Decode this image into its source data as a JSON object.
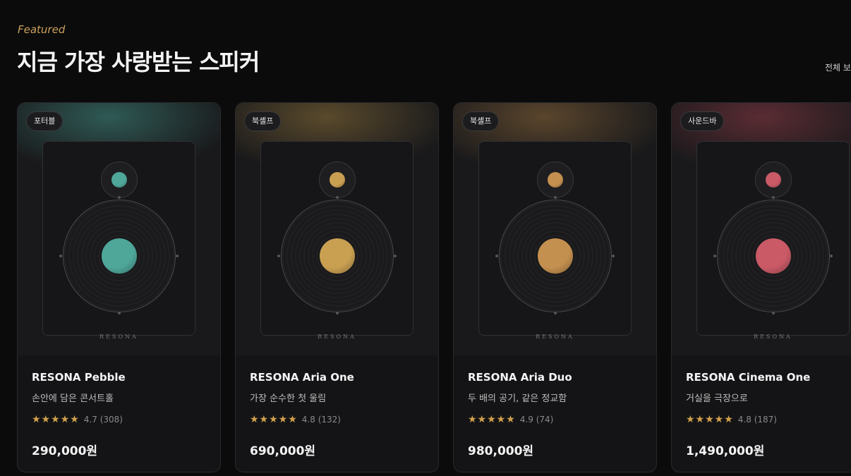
{
  "section": {
    "eyebrow": "Featured",
    "title": "지금 가장 사랑받는 스피커",
    "view_all": "전체 보기"
  },
  "colors": {
    "accent": "#c9a05c",
    "star": "#d4a24c",
    "background": "#0b0b0c"
  },
  "products": [
    {
      "category": "포터블",
      "brand": "RESONA",
      "name": "RESONA Pebble",
      "tagline": "손안에 담은 콘서트홀",
      "stars": "★★★★★",
      "rating": "4.7",
      "reviews": "(308)",
      "price": "290,000원",
      "color": "#4fa79a",
      "glow": "#2f5a55"
    },
    {
      "category": "북셸프",
      "brand": "RESONA",
      "name": "RESONA Aria One",
      "tagline": "가장 순수한 첫 울림",
      "stars": "★★★★★",
      "rating": "4.8",
      "reviews": "(132)",
      "price": "690,000원",
      "color": "#c9a052",
      "glow": "#5a4a2c"
    },
    {
      "category": "북셸프",
      "brand": "RESONA",
      "name": "RESONA Aria Duo",
      "tagline": "두 배의 공기, 같은 정교함",
      "stars": "★★★★★",
      "rating": "4.9",
      "reviews": "(74)",
      "price": "980,000원",
      "color": "#c4904f",
      "glow": "#5a452c"
    },
    {
      "category": "사운드바",
      "brand": "RESONA",
      "name": "RESONA Cinema One",
      "tagline": "거실을 극장으로",
      "stars": "★★★★★",
      "rating": "4.8",
      "reviews": "(187)",
      "price": "1,490,000원",
      "color": "#c95a66",
      "glow": "#5a2c33"
    }
  ]
}
